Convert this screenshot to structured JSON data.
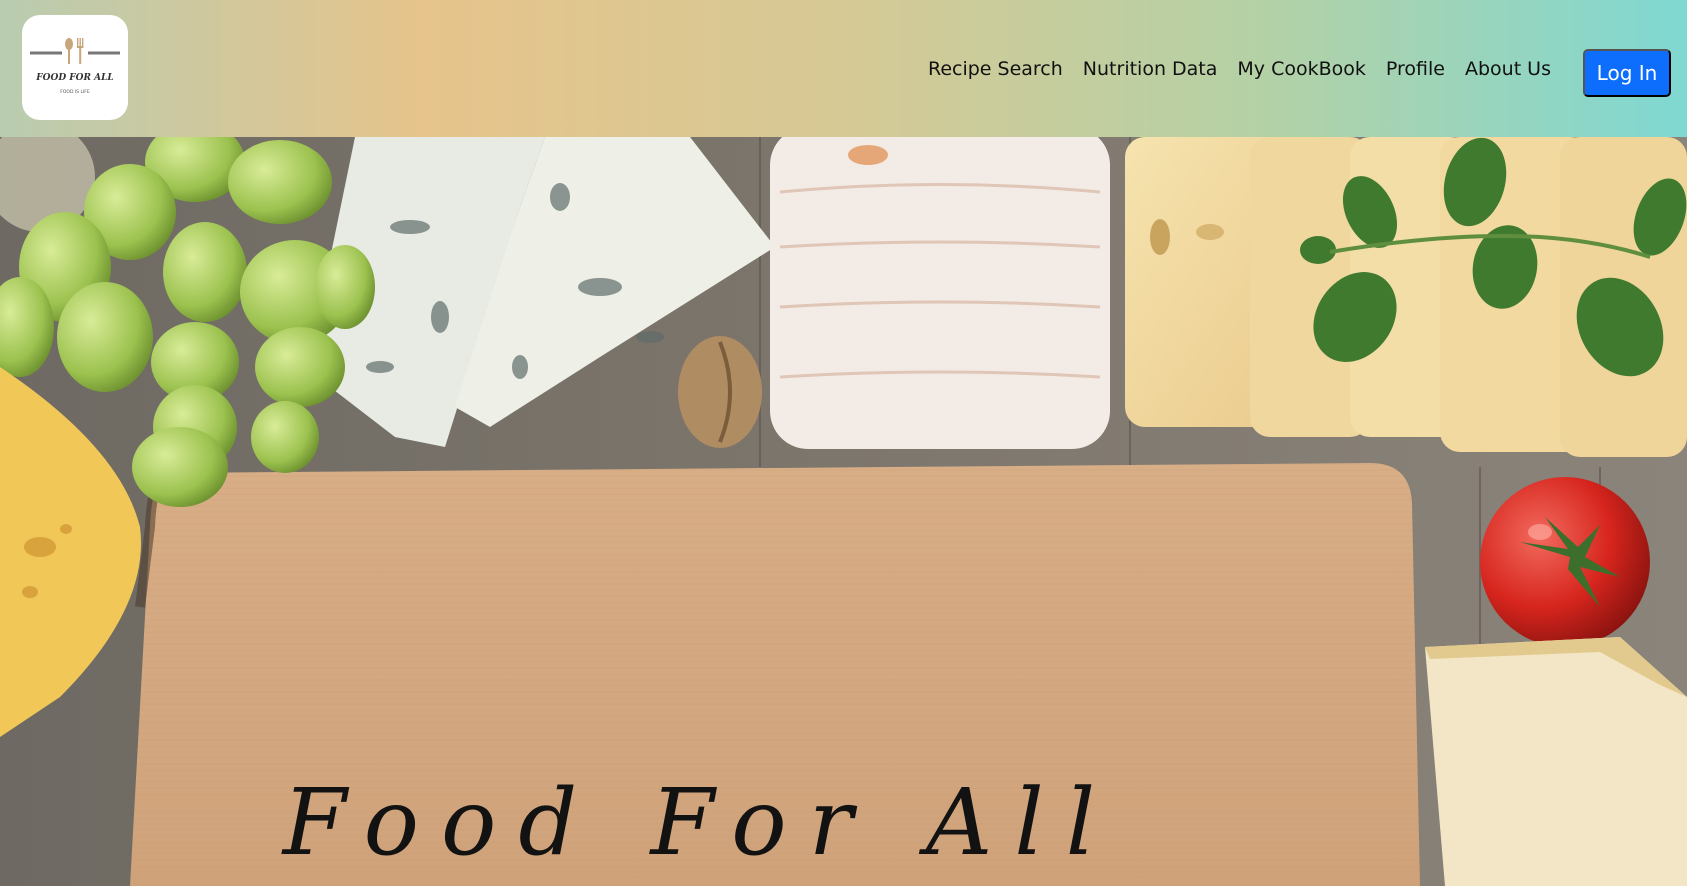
{
  "brand": {
    "logo_title": "FOOD FOR ALL",
    "logo_tagline": "FOOD IS LIFE",
    "logo_icon": "fork-spoon-icon"
  },
  "nav": {
    "items": [
      {
        "label": "Recipe Search"
      },
      {
        "label": "Nutrition Data"
      },
      {
        "label": "My CookBook"
      },
      {
        "label": "Profile"
      },
      {
        "label": "About Us"
      }
    ],
    "login_label": "Log In"
  },
  "hero": {
    "title": "Food For All"
  },
  "colors": {
    "accent": "#0d6efd",
    "nav_gradient_left": "#b9ccb0",
    "nav_gradient_mid": "#e6c48b",
    "nav_gradient_right": "#7fd8d2"
  }
}
